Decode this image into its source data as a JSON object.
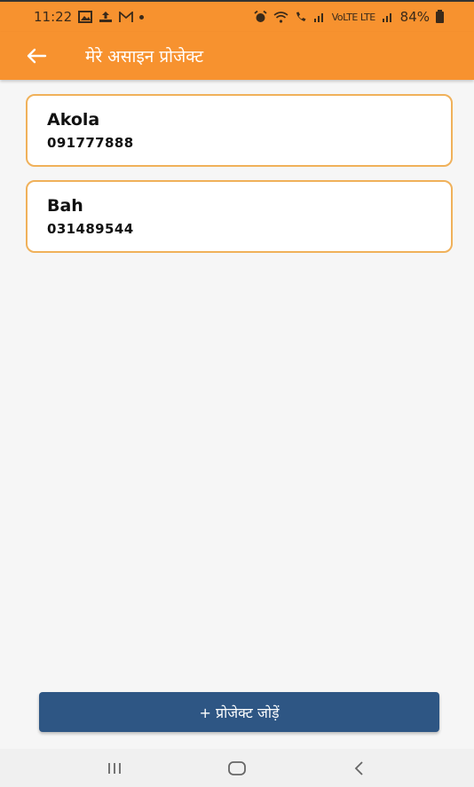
{
  "status_bar": {
    "time": "11:22",
    "battery": "84%",
    "network_label": "VoLTE LTE",
    "icons": [
      "gallery-icon",
      "upload-icon",
      "mail-icon",
      "dot-icon",
      "alarm-icon",
      "wifi-icon",
      "call-signal-icon",
      "signal-icon",
      "signal-icon",
      "battery-icon"
    ]
  },
  "app_bar": {
    "title": "मेरे असाइन प्रोजेक्ट",
    "back_icon": "back-arrow-icon"
  },
  "projects": [
    {
      "name": "Akola",
      "phone": "091777888"
    },
    {
      "name": "Bah",
      "phone": "031489544"
    }
  ],
  "add_button": {
    "label": "+ प्रोजेक्ट जोड़ें"
  },
  "nav_bar": {
    "icons": [
      "recent-apps-icon",
      "home-icon",
      "back-icon"
    ]
  },
  "colors": {
    "primary": "#f7922f",
    "card_border": "#f0b15a",
    "button": "#2e5684",
    "background": "#f6f6f6"
  }
}
